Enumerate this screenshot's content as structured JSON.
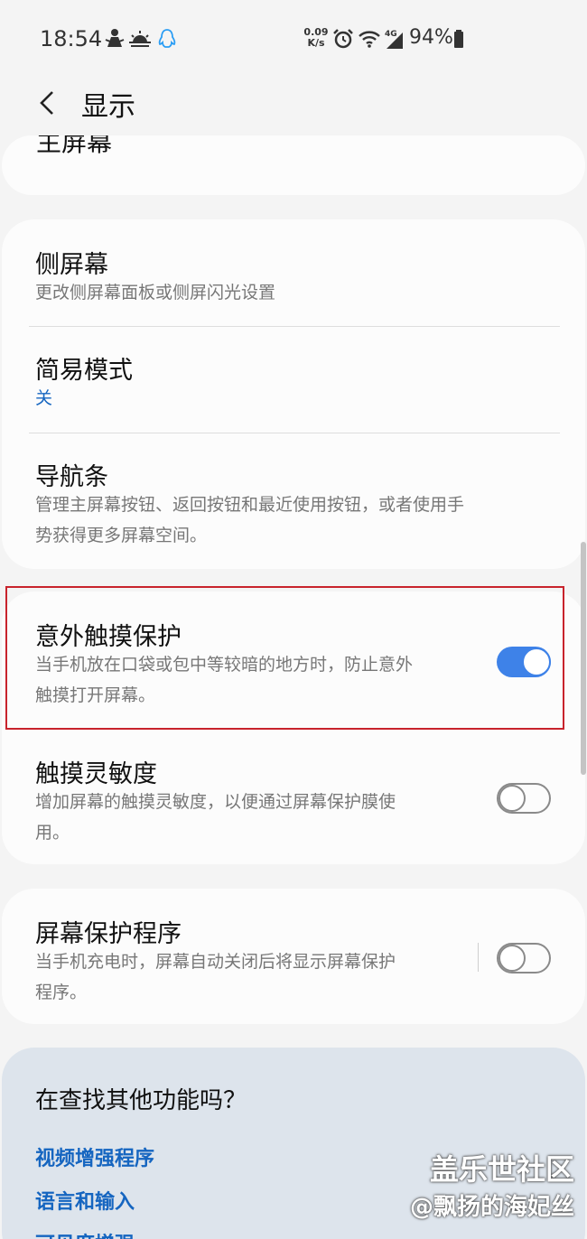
{
  "status_bar": {
    "time": "18:54",
    "net_speed_value": "0.09",
    "net_speed_unit": "K/s",
    "network_type": "4G",
    "battery_percent": "94%",
    "icons": [
      "notification-person-icon",
      "weather-sunrise-icon",
      "qq-penguin-icon",
      "alarm-icon",
      "wifi-icon",
      "signal-icon",
      "battery-icon"
    ]
  },
  "header": {
    "title": "显示"
  },
  "partial_item": {
    "title": "主屏幕"
  },
  "group1": {
    "items": [
      {
        "title": "侧屏幕",
        "subtitle": "更改侧屏幕面板或侧屏闪光设置"
      },
      {
        "title": "简易模式",
        "subtitle": "关"
      },
      {
        "title": "导航条",
        "subtitle_line1": "管理主屏幕按钮、返回按钮和最近使用按钮，或者使用手",
        "subtitle_line2": "势获得更多屏幕空间。"
      }
    ]
  },
  "group2": {
    "items": [
      {
        "title": "意外触摸保护",
        "subtitle_line1": "当手机放在口袋或包中等较暗的地方时，防止意外",
        "subtitle_line2": "触摸打开屏幕。",
        "toggle": "on"
      },
      {
        "title": "触摸灵敏度",
        "subtitle_line1": "增加屏幕的触摸灵敏度，以便通过屏幕保护膜使",
        "subtitle_line2": "用。",
        "toggle": "off"
      }
    ]
  },
  "group3": {
    "items": [
      {
        "title": "屏幕保护程序",
        "subtitle_line1": "当手机充电时，屏幕自动关闭后将显示屏幕保护",
        "subtitle_line2": "程序。",
        "toggle": "off"
      }
    ]
  },
  "suggestions": {
    "title": "在查找其他功能吗？",
    "links": [
      "视频增强程序",
      "语言和输入",
      "可见度增强"
    ]
  },
  "watermark": {
    "line1": "盖乐世社区",
    "line2": "@飘扬的海妃丝"
  },
  "colors": {
    "accent": "#3e82e8",
    "link": "#1565c0",
    "highlight_border": "#c8232c",
    "background": "#f4f4f4",
    "card": "#fcfcfc",
    "suggestion_card": "#dde4ec"
  }
}
